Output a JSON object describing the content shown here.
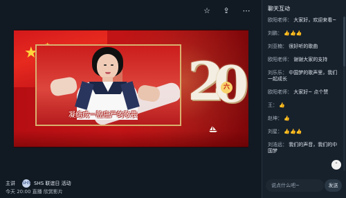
{
  "topbar": {
    "star_icon": "star-outline-icon",
    "share_icon": "share-icon",
    "more_icon": "more-icon"
  },
  "video": {
    "caption": "凝结成一腔庄严的敬畏",
    "medal_text": "六"
  },
  "info": {
    "host_label": "主讲",
    "channel_avatar": "SHS",
    "channel_name": "SHS 联谊日 活动",
    "meta": "今天 20:00  直播 欣赏影片"
  },
  "sidebar": {
    "title": "聊天互动",
    "messages": [
      {
        "name": "欧阳老师：",
        "text": "大家好，欢迎来看~"
      },
      {
        "name": "刘鹏：",
        "text": "👍👍👍"
      },
      {
        "name": "刘亚楠：",
        "text": "很好听的歌曲"
      },
      {
        "name": "欧阳老师：",
        "text": "谢谢大家的支持"
      },
      {
        "name": "刘乐乐：",
        "text": "中国梦的歌声里，我们一起成长"
      },
      {
        "name": "欧阳老师：",
        "text": "大家好~ 点个赞"
      },
      {
        "name": "王：",
        "text": "👍"
      },
      {
        "name": "赵坤：",
        "text": "👍"
      },
      {
        "name": "刘星：",
        "text": "👍👍👍"
      },
      {
        "name": "刘浩远：",
        "text": "我们的声音，我们的中国梦"
      }
    ],
    "round_button": "⌃",
    "input_placeholder": "说点什么吧~",
    "send_label": "发送"
  }
}
